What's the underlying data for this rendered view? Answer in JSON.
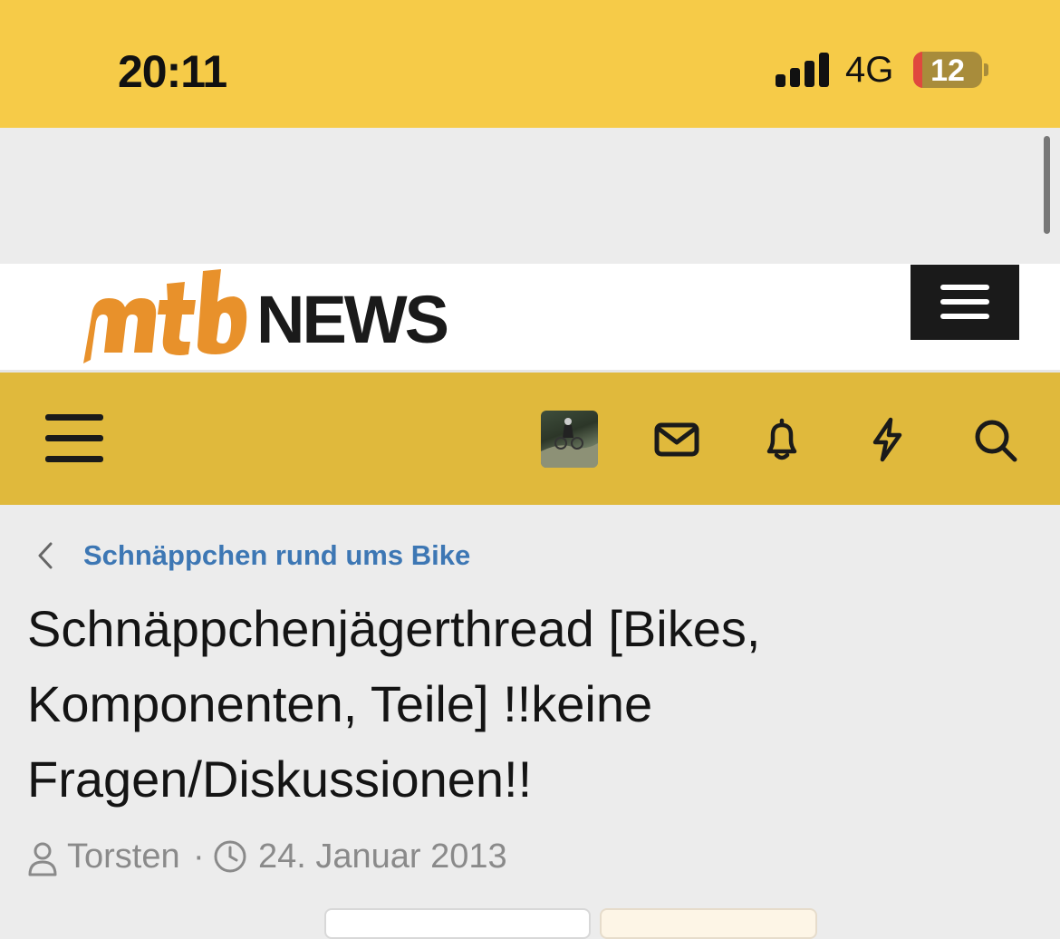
{
  "status_bar": {
    "time": "20:11",
    "network": "4G",
    "battery_level": "12",
    "battery_color": "#e0483e"
  },
  "logo": {
    "mtb": "mtb",
    "news": "NEWS",
    "mtb_color": "#e8912b"
  },
  "nav": {
    "icons": [
      "menu-icon",
      "avatar",
      "mail-icon",
      "bell-icon",
      "lightning-icon",
      "search-icon"
    ],
    "bar_color": "#e0b93c"
  },
  "breadcrumb": {
    "label": "Schnäppchen rund ums Bike",
    "color": "#3d77b4"
  },
  "thread": {
    "title_lines": [
      "Schnäppchenjägerthread [Bikes,",
      "Komponenten, Teile] !!keine",
      "Fragen/Diskussionen!!"
    ],
    "author": "Torsten",
    "separator": "·",
    "date": "24. Januar 2013"
  }
}
